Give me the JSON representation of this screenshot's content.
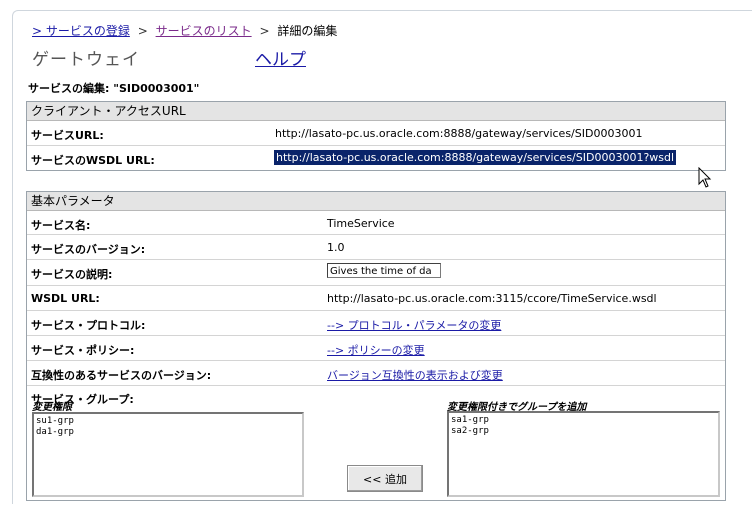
{
  "breadcrumb": {
    "link1": "> サービスの登録",
    "sep1": ">",
    "link2": "サービスのリスト",
    "sep2": ">",
    "current": "詳細の編集"
  },
  "header": {
    "title": "ゲートウェイ",
    "help": "ヘルプ"
  },
  "edit_title": "サービスの編集: \"SID0003001\"",
  "client_access": {
    "heading": "クライアント・アクセスURL",
    "service_url_label": "サービスURL:",
    "service_url_value": "http://lasato-pc.us.oracle.com:8888/gateway/services/SID0003001",
    "wsdl_url_label": "サービスのWSDL URL:",
    "wsdl_url_value": "http://lasato-pc.us.oracle.com:8888/gateway/services/SID0003001?wsdl"
  },
  "basic_params": {
    "heading": "基本パラメータ",
    "name_label": "サービス名:",
    "name_value": "TimeService",
    "version_label": "サービスのバージョン:",
    "version_value": "1.0",
    "description_label": "サービスの説明:",
    "description_value": "Gives the time of da",
    "wsdl_label": "WSDL URL:",
    "wsdl_value": "http://lasato-pc.us.oracle.com:3115/ccore/TimeService.wsdl",
    "protocol_label": "サービス・プロトコル:",
    "protocol_link": "--> プロトコル・パラメータの変更",
    "policy_label": "サービス・ポリシー:",
    "policy_link": "--> ポリシーの変更",
    "compat_label": "互換性のあるサービスのバージョン:",
    "compat_link": "バージョン互換性の表示および変更",
    "groups_label": "サービス・グループ:"
  },
  "groups": {
    "left_heading": "変更権限",
    "left_items": [
      "su1-grp",
      "da1-grp"
    ],
    "right_heading": "変更権限付きでグループを追加",
    "right_items": [
      "sa1-grp",
      "sa2-grp"
    ],
    "add_button": "<<  追加"
  }
}
